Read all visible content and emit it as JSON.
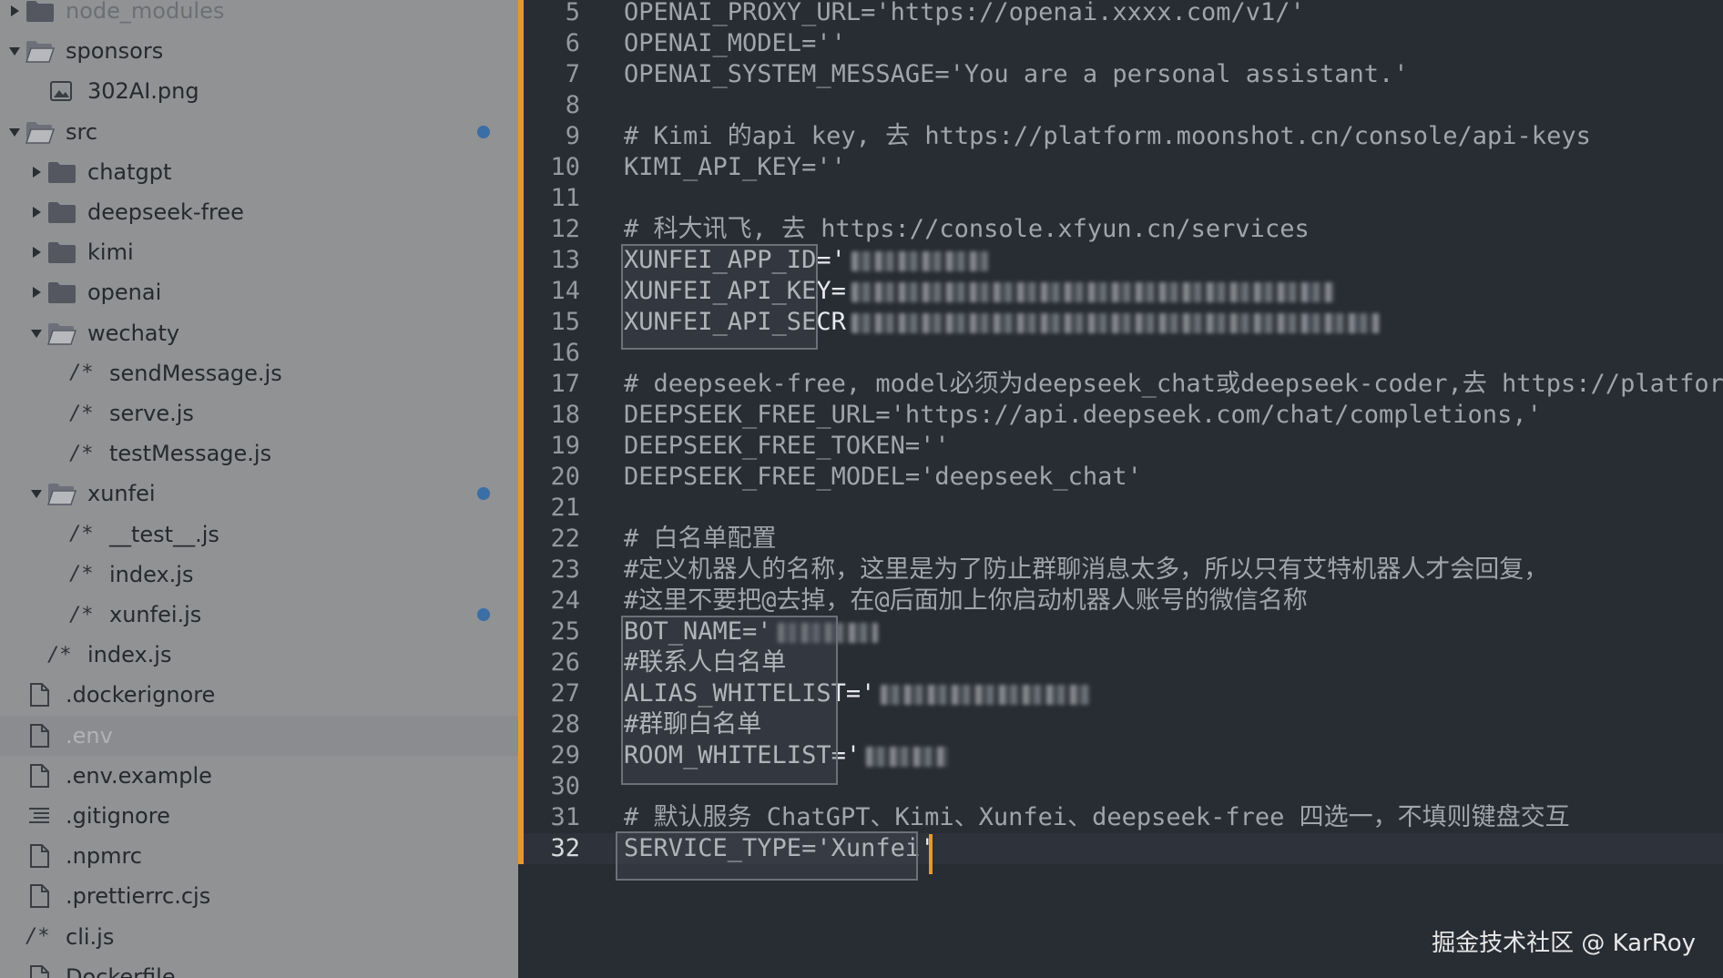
{
  "sidebar": {
    "items": [
      {
        "label": "node_modules",
        "type": "folder",
        "indent": 0,
        "arrow": "right",
        "dimmed": true
      },
      {
        "label": "sponsors",
        "type": "folder-open",
        "indent": 0,
        "arrow": "down"
      },
      {
        "label": "302AI.png",
        "type": "image",
        "indent": 1,
        "arrow": "none"
      },
      {
        "label": "src",
        "type": "folder-open",
        "indent": 0,
        "arrow": "down",
        "modified": true
      },
      {
        "label": "chatgpt",
        "type": "folder",
        "indent": 1,
        "arrow": "right"
      },
      {
        "label": "deepseek-free",
        "type": "folder",
        "indent": 1,
        "arrow": "right"
      },
      {
        "label": "kimi",
        "type": "folder",
        "indent": 1,
        "arrow": "right"
      },
      {
        "label": "openai",
        "type": "folder",
        "indent": 1,
        "arrow": "right"
      },
      {
        "label": "wechaty",
        "type": "folder-open",
        "indent": 1,
        "arrow": "down"
      },
      {
        "label": "sendMessage.js",
        "type": "js",
        "indent": 2,
        "arrow": "none"
      },
      {
        "label": "serve.js",
        "type": "js",
        "indent": 2,
        "arrow": "none"
      },
      {
        "label": "testMessage.js",
        "type": "js",
        "indent": 2,
        "arrow": "none"
      },
      {
        "label": "xunfei",
        "type": "folder-open",
        "indent": 1,
        "arrow": "down",
        "modified": true
      },
      {
        "label": "__test__.js",
        "type": "js",
        "indent": 2,
        "arrow": "none"
      },
      {
        "label": "index.js",
        "type": "js",
        "indent": 2,
        "arrow": "none"
      },
      {
        "label": "xunfei.js",
        "type": "js",
        "indent": 2,
        "arrow": "none",
        "modified": true
      },
      {
        "label": "index.js",
        "type": "js",
        "indent": 1,
        "arrow": "none"
      },
      {
        "label": ".dockerignore",
        "type": "file",
        "indent": 0,
        "arrow": "none"
      },
      {
        "label": ".env",
        "type": "file",
        "indent": 0,
        "arrow": "none",
        "selected": true
      },
      {
        "label": ".env.example",
        "type": "file",
        "indent": 0,
        "arrow": "none"
      },
      {
        "label": ".gitignore",
        "type": "lines",
        "indent": 0,
        "arrow": "none"
      },
      {
        "label": ".npmrc",
        "type": "file",
        "indent": 0,
        "arrow": "none"
      },
      {
        "label": ".prettierrc.cjs",
        "type": "file",
        "indent": 0,
        "arrow": "none"
      },
      {
        "label": "cli.js",
        "type": "js",
        "indent": 0,
        "arrow": "none"
      },
      {
        "label": "Dockerfile",
        "type": "file",
        "indent": 0,
        "arrow": "none"
      }
    ],
    "js_icon_text": "/*"
  },
  "editor": {
    "current_line": 32,
    "lines": [
      {
        "n": "5",
        "text": "OPENAI_PROXY_URL='https://openai.xxxx.com/v1/'"
      },
      {
        "n": "6",
        "text": "OPENAI_MODEL=''"
      },
      {
        "n": "7",
        "text": "OPENAI_SYSTEM_MESSAGE='You are a personal assistant.'"
      },
      {
        "n": "8",
        "text": ""
      },
      {
        "n": "9",
        "text": "# Kimi 的api key, 去 https://platform.moonshot.cn/console/api-keys"
      },
      {
        "n": "10",
        "text": "KIMI_API_KEY=''"
      },
      {
        "n": "11",
        "text": ""
      },
      {
        "n": "12",
        "text": "# 科大讯飞, 去 https://console.xfyun.cn/services"
      },
      {
        "n": "13",
        "text": "XUNFEI_APP_ID='",
        "hl": true,
        "blur": 150
      },
      {
        "n": "14",
        "text": "XUNFEI_API_KEY=",
        "hl": true,
        "blur": 530
      },
      {
        "n": "15",
        "text": "XUNFEI_API_SECR",
        "hl": true,
        "blur": 580
      },
      {
        "n": "16",
        "text": ""
      },
      {
        "n": "17",
        "text": "# deepseek-free, model必须为deepseek_chat或deepseek-coder,去 https://platform"
      },
      {
        "n": "18",
        "text": "DEEPSEEK_FREE_URL='https://api.deepseek.com/chat/completions,'"
      },
      {
        "n": "19",
        "text": "DEEPSEEK_FREE_TOKEN=''"
      },
      {
        "n": "20",
        "text": "DEEPSEEK_FREE_MODEL='deepseek_chat'"
      },
      {
        "n": "21",
        "text": ""
      },
      {
        "n": "22",
        "text": "# 白名单配置"
      },
      {
        "n": "23",
        "text": "#定义机器人的名称，这里是为了防止群聊消息太多，所以只有艾特机器人才会回复，"
      },
      {
        "n": "24",
        "text": "#这里不要把@去掉，在@后面加上你启动机器人账号的微信名称"
      },
      {
        "n": "25",
        "text": "BOT_NAME='",
        "hl": true,
        "blur": 110
      },
      {
        "n": "26",
        "text": "#联系人白名单",
        "hl": true
      },
      {
        "n": "27",
        "text": "ALIAS_WHITELIST='",
        "hl": true,
        "blur": 230
      },
      {
        "n": "28",
        "text": "#群聊白名单",
        "hl": true
      },
      {
        "n": "29",
        "text": "ROOM_WHITELIST='",
        "hl": true,
        "blur": 90
      },
      {
        "n": "30",
        "text": ""
      },
      {
        "n": "31",
        "text": "# 默认服务 ChatGPT、Kimi、Xunfei、deepseek-free 四选一，不填则键盘交互"
      },
      {
        "n": "32",
        "text": "SERVICE_TYPE='Xunfei'",
        "hl": true
      }
    ]
  },
  "watermark": "掘金技术社区 @ KarRoy",
  "colors": {
    "accent": "#e39a2d",
    "modified_dot": "#3a6ea5",
    "editor_bg": "#282c33",
    "sidebar_bg": "#909294"
  }
}
